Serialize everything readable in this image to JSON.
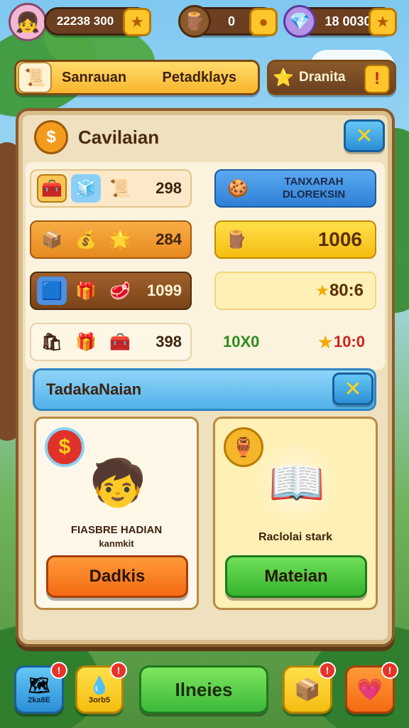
{
  "colors": {
    "panel_bg": "#efe0bf",
    "accent_blue": "#3aa3e8",
    "accent_gold": "#ffc62b",
    "accent_orange": "#f7761b",
    "accent_green": "#3cb83a",
    "brown": "#6b3f1f"
  },
  "top_bar": {
    "avatar_icon": "girl-avatar-icon",
    "resources": [
      {
        "icon": "player-level-icon",
        "value": "22238 300"
      },
      {
        "icon": "wood-log-icon",
        "value": "0"
      },
      {
        "icon": "gem-icon",
        "value": "18 0030"
      }
    ]
  },
  "banners": {
    "left": {
      "icon": "scroll-icon",
      "label_a": "Sanrauan",
      "label_b": "Petadklays"
    },
    "right": {
      "icon": "star-character-icon",
      "label": "Dranita",
      "alert": "!"
    }
  },
  "panel": {
    "title": "Cavilaian",
    "title_icon": "coin-icon",
    "close_symbol": "✕",
    "rows": [
      {
        "items": [
          "treasure-chest-icon",
          "blue-crate-icon",
          "scroll-roll-icon"
        ],
        "value": "298"
      },
      {
        "items": [
          "wooden-crate-icon",
          "gold-bag-icon",
          "star-icon"
        ],
        "value": "284"
      },
      {
        "items": [
          "blue-box-icon",
          "gold-box-icon",
          "meat-icon"
        ],
        "value": "1099"
      },
      {
        "items": [
          "gift-bag-icon",
          "red-gift-icon",
          "treasure-chest-icon"
        ],
        "value": "398"
      }
    ],
    "right_rows": [
      {
        "line1": "TANXARAH",
        "line2": "DLOREKSIN",
        "icon": "cookie-icon"
      },
      {
        "value": "1006",
        "icon": "wood-piece-icon"
      },
      {
        "value": "80:6",
        "icon": "star-icon"
      },
      {
        "value_a": "10X0",
        "value_b": "10:0",
        "icon": "star-icon"
      }
    ],
    "section": {
      "title": "TadakaNaian",
      "close_symbol": "✕"
    },
    "cards": [
      {
        "badge": "$",
        "art_icon": "boy-reading-icon",
        "caption_1": "FIASBRE HADIAN",
        "caption_2": "kanmkit",
        "button": "Dadkis"
      },
      {
        "art_icon": "boy-with-book-icon",
        "caption_1": "Raclolai stark",
        "button": "Mateian"
      }
    ]
  },
  "bottom_bar": {
    "left_1": {
      "label": "2ka8E",
      "icon": "map-icon",
      "alert": "!"
    },
    "left_2": {
      "label": "3orb5",
      "icon": "water-drop-icon",
      "alert": "!"
    },
    "center": {
      "label": "Ilneies"
    },
    "right_1": {
      "icon": "inventory-box-icon",
      "alert": "!"
    },
    "right_2": {
      "icon": "heart-icon",
      "alert": "!"
    }
  }
}
